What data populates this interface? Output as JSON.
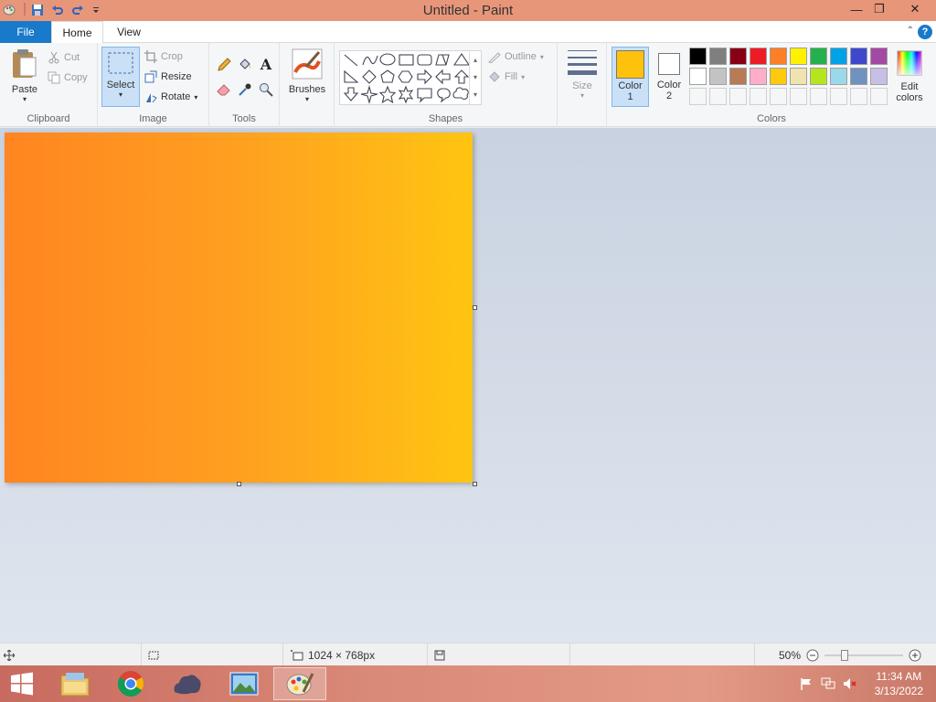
{
  "window": {
    "title": "Untitled - Paint",
    "buttons": {
      "minimize": "—",
      "restore": "❐",
      "close": "✕"
    }
  },
  "quick_access": [
    "save-icon",
    "undo-icon",
    "redo-icon",
    "customize-icon"
  ],
  "tabs": [
    {
      "label": "File",
      "active": false
    },
    {
      "label": "Home",
      "active": true
    },
    {
      "label": "View",
      "active": false
    }
  ],
  "ribbon": {
    "clipboard": {
      "group_label": "Clipboard",
      "paste": "Paste",
      "cut": "Cut",
      "copy": "Copy"
    },
    "image": {
      "group_label": "Image",
      "select": "Select",
      "crop": "Crop",
      "resize": "Resize",
      "rotate": "Rotate"
    },
    "tools": {
      "group_label": "Tools"
    },
    "brushes": {
      "label": "Brushes"
    },
    "shapes": {
      "group_label": "Shapes",
      "outline": "Outline",
      "fill": "Fill"
    },
    "size": {
      "label": "Size"
    },
    "color1": {
      "label": "Color",
      "num": "1",
      "value": "#fec20d"
    },
    "color2": {
      "label": "Color",
      "num": "2",
      "value": "#ffffff"
    },
    "colors": {
      "group_label": "Colors",
      "edit_label_1": "Edit",
      "edit_label_2": "colors",
      "row1": [
        "#000000",
        "#7f7f7f",
        "#880015",
        "#ed1c24",
        "#ff7f27",
        "#fff200",
        "#22b14c",
        "#00a2e8",
        "#3f48cc",
        "#a349a4"
      ],
      "row2": [
        "#ffffff",
        "#c3c3c3",
        "#b97a57",
        "#ffaec9",
        "#ffc90e",
        "#efe4b0",
        "#b5e61d",
        "#99d9ea",
        "#7092be",
        "#c8bfe7"
      ]
    }
  },
  "canvas": {
    "gradient_start": "#ff8520",
    "gradient_end": "#ffc412"
  },
  "status": {
    "dimensions": "1024 × 768px",
    "zoom": "50%"
  },
  "taskbar": {
    "apps": [
      "start-icon",
      "file-explorer-icon",
      "chrome-icon",
      "app-icon",
      "photos-icon",
      "paint-icon"
    ],
    "time": "11:34 AM",
    "date": "3/13/2022"
  }
}
